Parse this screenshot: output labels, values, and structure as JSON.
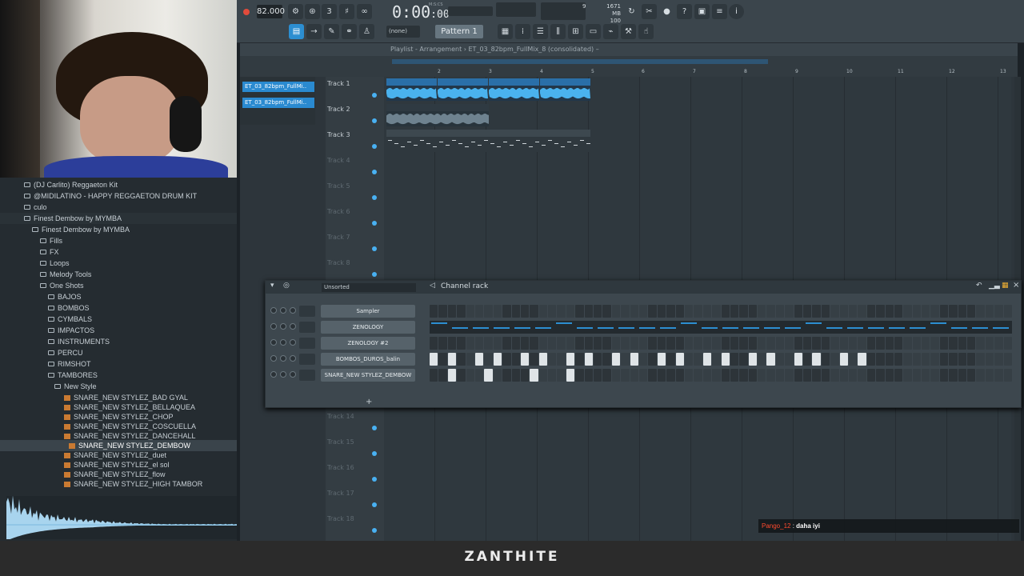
{
  "toolbar": {
    "tempo": "82.000",
    "time": "0:00",
    "time_frac": ":00",
    "time_units": "M:S:CS",
    "cpu": "9",
    "memory": "1671 MB",
    "polyphony": "100",
    "snap": "(none)",
    "pattern": "Pattern 1"
  },
  "playlist": {
    "title": "Playlist - Arrangement › ET_03_82bpm_FullMix_8 (consolidated) –",
    "clip_list": [
      "ET_03_82bpm_FullMi..",
      "ET_03_82bpm_FullMi.."
    ],
    "ruler": [
      "2",
      "3",
      "4",
      "5",
      "6",
      "7",
      "8",
      "9",
      "10",
      "11",
      "12",
      "13"
    ],
    "tracks": [
      "Track 1",
      "Track 2",
      "Track 3",
      "Track 4",
      "Track 5",
      "Track 6",
      "Track 7",
      "Track 8",
      "Track 14",
      "Track 15",
      "Track 16",
      "Track 17",
      "Track 18"
    ],
    "audio_clip_label": "ET_03_82..idated)",
    "pattern_clip_label": "Pattern 1"
  },
  "browser": {
    "items": [
      "(DJ Carlito) Reggaeton Kit",
      "@MIDILATINO - HAPPY REGGAETON DRUM KIT",
      "culo",
      "Finest Dembow by MYMBA",
      "Finest Dembow by MYMBA",
      "Fills",
      "FX",
      "Loops",
      "Melody Tools",
      "One Shots",
      "BAJOS",
      "BOMBOS",
      "CYMBALS",
      "IMPACTOS",
      "INSTRUMENTS",
      "PERCU",
      "RIMSHOT",
      "TAMBORES",
      "New Style",
      "SNARE_NEW STYLEZ_BAD GYAL",
      "SNARE_NEW STYLEZ_BELLAQUEA",
      "SNARE_NEW STYLEZ_CHOP",
      "SNARE_NEW STYLEZ_COSCUELLA",
      "SNARE_NEW STYLEZ_DANCEHALL",
      "SNARE_NEW STYLEZ_DEMBOW",
      "SNARE_NEW STYLEZ_duet",
      "SNARE_NEW STYLEZ_el sol",
      "SNARE_NEW STYLEZ_flow",
      "SNARE_NEW STYLEZ_HIGH TAMBOR"
    ]
  },
  "rack": {
    "filter": "Unsorted",
    "title": "Channel rack",
    "add": "+",
    "channels": [
      "Sampler",
      "ZENOLOGY",
      "ZENOLOGY #2",
      "BOMBOS_DUROS_balin",
      "SNARE_NEW STYLEZ_DEMBOW"
    ]
  },
  "chat": {
    "user": "Pango_12",
    "sep": " : ",
    "message": "daha iyi"
  },
  "banner": "ZANTHITE",
  "colors": {
    "accent": "#2c8ed1",
    "chat_user": "#ff4a2e",
    "wave": "#4ab2ee"
  }
}
